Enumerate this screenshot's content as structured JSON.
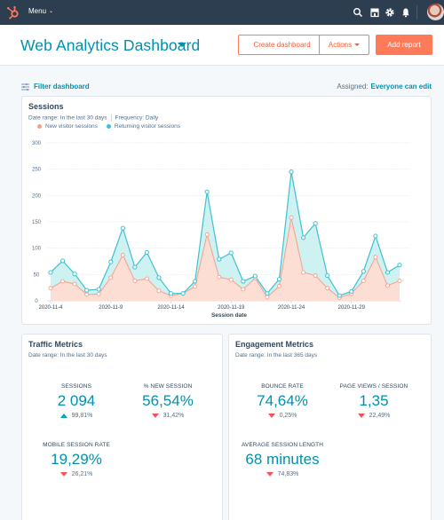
{
  "topnav": {
    "menu_label": "Menu",
    "icons": [
      "search-icon",
      "marketplace-icon",
      "settings-icon",
      "notifications-icon"
    ]
  },
  "header": {
    "title": "Web Analytics Dashboard",
    "buttons": {
      "create_dashboard": "Create dashboard",
      "actions": "Actions",
      "add_report": "Add report"
    }
  },
  "filter_bar": {
    "filter_label": "Filter dashboard",
    "assigned_label": "Assigned:",
    "assigned_value": "Everyone can edit"
  },
  "sessions_card": {
    "title": "Sessions",
    "date_range": "Date range: In the last 30 days",
    "frequency": "Frequency: Daily"
  },
  "chart_data": {
    "type": "area",
    "title": "Sessions",
    "xlabel": "Session date",
    "ylabel": "",
    "ylim": [
      0,
      300
    ],
    "yticks": [
      0,
      50,
      100,
      150,
      200,
      250,
      300
    ],
    "xtick_labels": [
      "2020-11-4",
      "2020-11-9",
      "2020-11-14",
      "2020-11-19",
      "2020-11-24",
      "2020-11-29"
    ],
    "xtick_indices": [
      0,
      5,
      10,
      15,
      20,
      25
    ],
    "grid": true,
    "legend_position": "top-left",
    "stacked": true,
    "x": [
      "2020-11-4",
      "2020-11-5",
      "2020-11-6",
      "2020-11-7",
      "2020-11-8",
      "2020-11-9",
      "2020-11-10",
      "2020-11-11",
      "2020-11-12",
      "2020-11-13",
      "2020-11-14",
      "2020-11-15",
      "2020-11-16",
      "2020-11-17",
      "2020-11-18",
      "2020-11-19",
      "2020-11-20",
      "2020-11-21",
      "2020-11-22",
      "2020-11-23",
      "2020-11-24",
      "2020-11-25",
      "2020-11-26",
      "2020-11-27",
      "2020-11-28",
      "2020-11-29",
      "2020-11-30",
      "2020-12-1",
      "2020-12-2",
      "2020-12-3"
    ],
    "series": [
      {
        "name": "New visitor sessions",
        "color": "#f5a08c",
        "fill": "#fddcd3",
        "values": [
          24,
          37,
          32,
          12,
          13,
          44,
          87,
          38,
          42,
          19,
          10,
          14,
          27,
          126,
          45,
          40,
          22,
          43,
          7,
          28,
          158,
          54,
          48,
          24,
          6,
          14,
          38,
          83,
          29,
          38
        ]
      },
      {
        "name": "Returning visitor sessions",
        "color": "#3fc1cf",
        "fill": "#c9eff1",
        "cumulative_values": [
          54,
          76,
          51,
          20,
          22,
          74,
          138,
          64,
          92,
          44,
          14,
          14,
          37,
          207,
          79,
          91,
          37,
          47,
          14,
          41,
          245,
          120,
          147,
          48,
          10,
          18,
          56,
          123,
          54,
          68
        ]
      }
    ]
  },
  "traffic_card": {
    "title": "Traffic Metrics",
    "date_range": "Date range: In the last 30 days",
    "metrics": [
      {
        "label": "SESSIONS",
        "value": "2 094",
        "change": "99,81%",
        "direction": "up"
      },
      {
        "label": "% NEW SESSION",
        "value": "56,54%",
        "change": "31,42%",
        "direction": "down"
      },
      {
        "label": "MOBILE SESSION RATE",
        "value": "19,29%",
        "change": "26,21%",
        "direction": "down"
      }
    ]
  },
  "engagement_card": {
    "title": "Engagement Metrics",
    "date_range": "Date range: In the last 365 days",
    "metrics": [
      {
        "label": "BOUNCE RATE",
        "value": "74,64%",
        "change": "0,25%",
        "direction": "down"
      },
      {
        "label": "PAGE VIEWS / SESSION",
        "value": "1,35",
        "change": "22,49%",
        "direction": "down"
      },
      {
        "label": "AVERAGE SESSION LENGTH",
        "value": "68 minutes",
        "change": "74,83%",
        "direction": "down"
      }
    ]
  }
}
